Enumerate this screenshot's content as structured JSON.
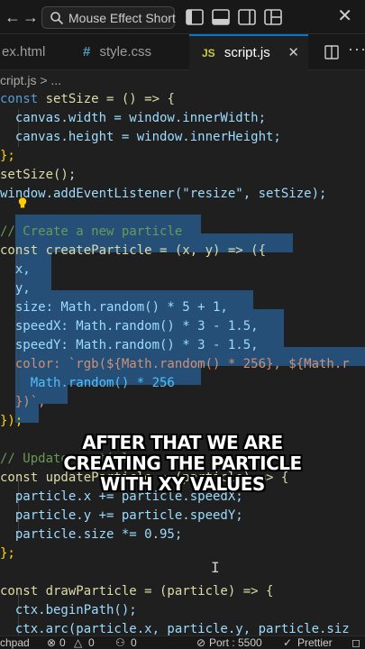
{
  "titlebar": {
    "search_text": "Mouse Effect Short",
    "back_glyph": "←",
    "forward_glyph": "→",
    "close_glyph": "✕"
  },
  "tabs": [
    {
      "label": "ex.html",
      "icon": ""
    },
    {
      "label": "style.css",
      "icon": "#"
    },
    {
      "label": "script.js",
      "icon": "JS",
      "close": "✕"
    }
  ],
  "breadcrumb": "cript.js > ...",
  "editor": {
    "lines": [
      "const setSize = () => {",
      "  canvas.width = window.innerWidth;",
      "  canvas.height = window.innerHeight;",
      "};",
      "setSize();",
      "window.addEventListener(\"resize\", setSize);",
      "",
      "// Create a new particle",
      "const createParticle = (x, y) => ({",
      "  x,",
      "  y,",
      "  size: Math.random() * 5 + 1,",
      "  speedX: Math.random() * 3 - 1.5,",
      "  speedY: Math.random() * 3 - 1.5,",
      "  color: `rgb(${Math.random() * 256}, ${Math.r",
      "    Math.random() * 256",
      "  })`,",
      "});",
      "",
      "// Update particle",
      "const updateParticle = (particle) => {",
      "  particle.x += particle.speedX;",
      "  particle.y += particle.speedY;",
      "  particle.size *= 0.95;",
      "};",
      "",
      "const drawParticle = (particle) => {",
      "  ctx.beginPath();",
      "  ctx.arc(particle.x, particle.y, particle.siz"
    ]
  },
  "caption": [
    "AFTER THAT WE ARE",
    "CREATING THE PARTICLE",
    "WITH XY VALUES"
  ],
  "statusbar": {
    "left_text": "chpad",
    "errors": "0",
    "warnings": "0",
    "ports_count": "0",
    "port": "Port : 5500",
    "prettier": "Prettier"
  },
  "colors": {
    "accent": "#0078d4",
    "selection": "#264f78",
    "keyword": "#569cd6",
    "function": "#dcdcaa",
    "variable": "#9cdcfe",
    "number": "#b5cea8",
    "string": "#ce9178",
    "comment": "#6a9955"
  },
  "icons": [
    "back-arrow-icon",
    "forward-arrow-icon",
    "search-icon",
    "toggle-sidebar-icon",
    "toggle-panel-icon",
    "toggle-secondary-sidebar-icon",
    "customize-layout-icon",
    "close-icon",
    "split-editor-icon",
    "more-actions-icon",
    "lightbulb-icon",
    "text-cursor-icon",
    "error-icon",
    "warning-icon",
    "ports-icon",
    "port-icon",
    "prettier-check-icon"
  ]
}
